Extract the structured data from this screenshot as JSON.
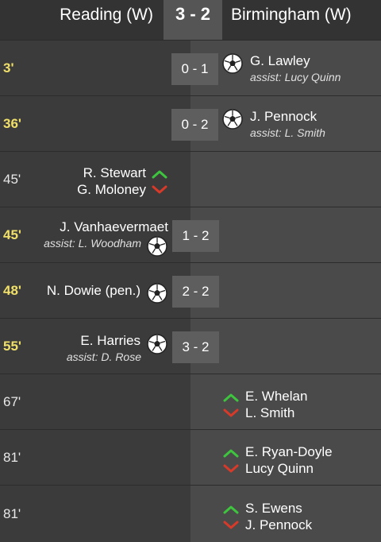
{
  "header": {
    "home_team": "Reading (W)",
    "away_team": "Birmingham (W)",
    "score": "3 - 2"
  },
  "colors": {
    "goal_minute": "#f0e06a",
    "sub_in": "#3ec43e",
    "sub_out": "#d83a2a"
  },
  "events": [
    {
      "minute": "3'",
      "type": "goal",
      "side": "away",
      "score": "0 - 1",
      "player": "G. Lawley",
      "assist": "assist: Lucy Quinn"
    },
    {
      "minute": "36'",
      "type": "goal",
      "side": "away",
      "score": "0 - 2",
      "player": "J. Pennock",
      "assist": "assist: L. Smith"
    },
    {
      "minute": "45'",
      "type": "substitution",
      "side": "home",
      "player_in": "R. Stewart",
      "player_out": "G. Moloney"
    },
    {
      "minute": "45'",
      "type": "goal",
      "side": "home",
      "score": "1 - 2",
      "player": "J. Vanhaevermaet",
      "assist": "assist: L. Woodham"
    },
    {
      "minute": "48'",
      "type": "goal",
      "side": "home",
      "score": "2 - 2",
      "player": "N. Dowie (pen.)"
    },
    {
      "minute": "55'",
      "type": "goal",
      "side": "home",
      "score": "3 - 2",
      "player": "E. Harries",
      "assist": "assist: D. Rose"
    },
    {
      "minute": "67'",
      "type": "substitution",
      "side": "away",
      "player_in": "E. Whelan",
      "player_out": "L. Smith"
    },
    {
      "minute": "81'",
      "type": "substitution",
      "side": "away",
      "player_in": "E. Ryan-Doyle",
      "player_out": "Lucy Quinn"
    },
    {
      "minute": "81'",
      "type": "substitution",
      "side": "away",
      "player_in": "S. Ewens",
      "player_out": "J. Pennock"
    }
  ]
}
